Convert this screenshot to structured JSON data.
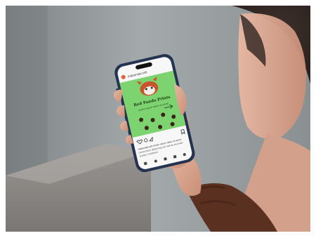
{
  "photo": {
    "background_colors": {
      "wall": "#9aa0a1",
      "wall_shadow": "#6f7576",
      "ledge": "#8b8886",
      "frame": "#ffffff"
    },
    "hand_skin": "#d9a58d",
    "sleeve_color": "#5a3020",
    "hair_color": "#4a3a33"
  },
  "phone": {
    "frame_color": "#24334f",
    "screen": {
      "app_header": "redpandacraft",
      "post_title": "Red Panda Prints",
      "post_subtitle": "Lorem ipsum dolor sit amet",
      "post_background": "#7dd36f",
      "caption_lines": [
        "redpandacraft Lorem ipsum dolor sit amet",
        "consectetur adipiscing elit sed do eiusmod",
        "tempor incididunt"
      ]
    }
  }
}
